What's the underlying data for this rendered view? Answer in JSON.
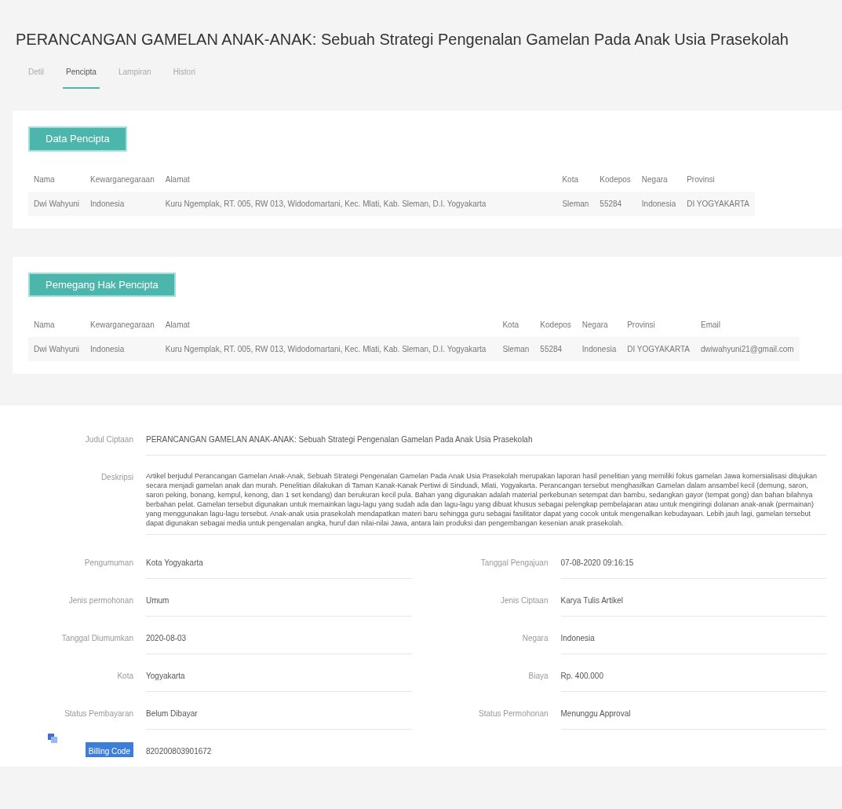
{
  "title": "PERANCANGAN GAMELAN ANAK-ANAK: Sebuah Strategi Pengenalan Gamelan Pada Anak Usia Prasekolah",
  "tabs": [
    {
      "label": "Detil",
      "selected": false
    },
    {
      "label": "Pencipta",
      "selected": true
    },
    {
      "label": "Lampiran",
      "selected": false
    },
    {
      "label": "Histori",
      "selected": false
    }
  ],
  "sections": [
    {
      "heading": "Data Pencipta",
      "columns": [
        "Nama",
        "Kewarganegaraan",
        "Alamat",
        "Kota",
        "Kodepos",
        "Negara",
        "Provinsi"
      ],
      "rows": [
        [
          "Dwi Wahyuni",
          "Indonesia",
          "Kuru Ngemplak, RT. 005, RW 013, Widodomartani, Kec. Mlati, Kab. Sleman, D.I. Yogyakarta",
          "Sleman",
          "55284",
          "Indonesia",
          "DI YOGYAKARTA"
        ]
      ]
    },
    {
      "heading": "Pemegang Hak Pencipta",
      "columns": [
        "Nama",
        "Kewarganegaraan",
        "Alamat",
        "Kota",
        "Kodepos",
        "Negara",
        "Provinsi",
        "Email"
      ],
      "rows": [
        [
          "Dwi Wahyuni",
          "Indonesia",
          "Kuru Ngemplak, RT. 005, RW 013, Widodomartani, Kec. Mlati, Kab. Sleman, D.I. Yogyakarta",
          "Sleman",
          "55284",
          "Indonesia",
          "DI YOGYAKARTA",
          "dwiwahyuni21@gmail.com"
        ]
      ]
    }
  ],
  "judul": {
    "label": "Judul Ciptaan",
    "value": "PERANCANGAN GAMELAN ANAK-ANAK: Sebuah Strategi Pengenalan Gamelan Pada Anak Usia Prasekolah"
  },
  "deskripsi": {
    "label": "Deskripsi",
    "value": "Artikel berjudul Perancangan Gamelan Anak-Anak, Sebuah Strategi Pengenalan Gamelan Pada Anak Usia Prasekolah merupakan laporan hasil penelitian yang memiliki fokus gamelan Jawa komersialisasi ditujukan secara menjadi gamelan anak dan murah. Penelitian dilakukan di Taman Kanak-Kanak Pertiwi di Sinduadi, Mlati, Yogyakarta. Perancangan tersebut menghasilkan Gamelan dalam ansambel kecil (demung, saron, saron peking, bonang, kempul, kenong, dan 1 set kendang) dan berukuran kecil pula. Bahan yang digunakan adalah material perkebunan setempat dan bambu, sedangkan gayor (tempat gong) dan bahan bilahnya berbahan pelat. Gamelan tersebut digunakan untuk memainkan lagu-lagu yang sudah ada dan lagu-lagu yang dibuat khusus sebagai pelengkap pembelajaran atau untuk mengiringi dolanan anak-anak (permainan) yang menggunakan lagu-lagu tersebut. Anak-anak usia prasekolah mendapatkan materi baru sehingga guru sebagai fasilitator dapat yang cocok untuk mengenalkan kebudayaan. Lebih jauh lagi, gamelan tersebut dapat digunakan sebagai media untuk pengenalan angka, huruf dan nilai-nilai Jawa, antara lain produksi dan pengembangan kesenian anak prasekolah."
  },
  "fields": [
    {
      "label": "Pengumuman",
      "value": "Kota Yogyakarta"
    },
    {
      "label": "Tanggal Pengajuan",
      "value": "07-08-2020 09:16:15"
    },
    {
      "label": "Jenis permohonan",
      "value": "Umum"
    },
    {
      "label": "Jenis Ciptaan",
      "value": "Karya Tulis Artikel"
    },
    {
      "label": "Tanggal Diumumkan",
      "value": "2020-08-03"
    },
    {
      "label": "Negara",
      "value": "Indonesia"
    },
    {
      "label": "Kota",
      "value": "Yogyakarta"
    },
    {
      "label": "Biaya",
      "value": "Rp. 400.000"
    },
    {
      "label": "Status Pembayaran",
      "value": "Belum Dibayar"
    },
    {
      "label": "Status Permohonan",
      "value": "Menunggu Approval"
    }
  ],
  "billing": {
    "label": "Billing Code",
    "value": "820200803901672",
    "selected": true
  }
}
